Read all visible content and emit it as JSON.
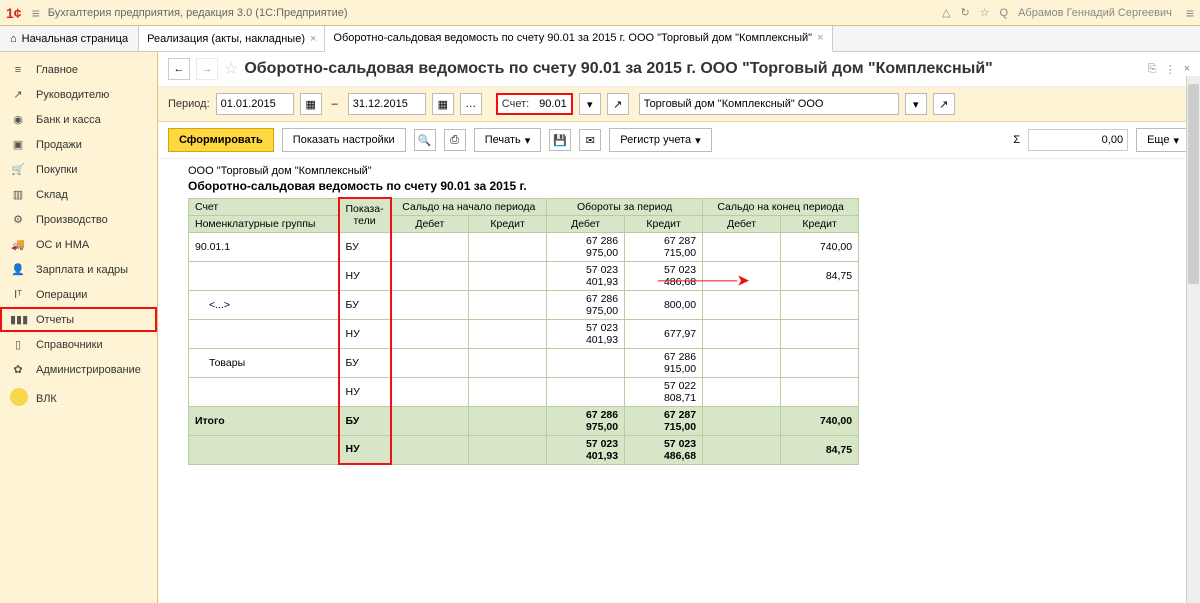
{
  "app": {
    "title": "Бухгалтерия предприятия, редакция 3.0   (1С:Предприятие)",
    "user": "Абрамов Геннадий Сергеевич"
  },
  "tabs": {
    "home": "Начальная страница",
    "t1": "Реализация (акты, накладные)",
    "t2": "Оборотно-сальдовая ведомость по счету 90.01 за 2015 г. ООО \"Торговый дом \"Комплексный\""
  },
  "sidebar": {
    "main": "Главное",
    "mgr": "Руководителю",
    "bank": "Банк и касса",
    "sales": "Продажи",
    "purch": "Покупки",
    "stock": "Склад",
    "prod": "Производство",
    "os": "ОС и НМА",
    "hr": "Зарплата и кадры",
    "ops": "Операции",
    "reports": "Отчеты",
    "refs": "Справочники",
    "admin": "Администрирование",
    "vlk": "ВЛК"
  },
  "header": {
    "title": "Оборотно-сальдовая ведомость по счету 90.01 за 2015 г. ООО \"Торговый дом \"Комплексный\""
  },
  "filter": {
    "period_label": "Период:",
    "from": "01.01.2015",
    "to": "31.12.2015",
    "acct_label": "Счет:",
    "acct": "90.01",
    "org": "Торговый дом \"Комплексный\" ООО"
  },
  "toolbar": {
    "form": "Сформировать",
    "settings": "Показать настройки",
    "print": "Печать",
    "register": "Регистр учета",
    "more": "Еще",
    "sum": "0,00"
  },
  "report": {
    "org": "ООО \"Торговый дом \"Комплексный\"",
    "title": "Оборотно-сальдовая ведомость по счету 90.01 за 2015 г.",
    "cols": {
      "acct": "Счет",
      "nom": "Номенклатурные группы",
      "ind": "Показа-\nтели",
      "sb": "Сальдо на начало периода",
      "to": "Обороты за период",
      "se": "Сальдо на конец периода",
      "d": "Дебет",
      "c": "Кредит"
    },
    "rows": [
      {
        "acct": "90.01.1",
        "ind": "БУ",
        "d": "",
        "c": "",
        "td": "67 286 975,00",
        "tc": "67 287 715,00",
        "ed": "",
        "ec": "740,00"
      },
      {
        "acct": "",
        "ind": "НУ",
        "d": "",
        "c": "",
        "td": "57 023 401,93",
        "tc": "57 023 486,68",
        "ed": "",
        "ec": "84,75"
      },
      {
        "acct": "<...>",
        "ind": "БУ",
        "d": "",
        "c": "",
        "td": "67 286 975,00",
        "tc": "800,00",
        "ed": "",
        "ec": ""
      },
      {
        "acct": "",
        "ind": "НУ",
        "d": "",
        "c": "",
        "td": "57 023 401,93",
        "tc": "677,97",
        "ed": "",
        "ec": ""
      },
      {
        "acct": "Товары",
        "ind": "БУ",
        "d": "",
        "c": "",
        "td": "",
        "tc": "67 286 915,00",
        "ed": "",
        "ec": ""
      },
      {
        "acct": "",
        "ind": "НУ",
        "d": "",
        "c": "",
        "td": "",
        "tc": "57 022 808,71",
        "ed": "",
        "ec": ""
      }
    ],
    "total_label": "Итого",
    "total": [
      {
        "ind": "БУ",
        "d": "",
        "c": "",
        "td": "67 286 975,00",
        "tc": "67 287 715,00",
        "ed": "",
        "ec": "740,00"
      },
      {
        "ind": "НУ",
        "d": "",
        "c": "",
        "td": "57 023 401,93",
        "tc": "57 023 486,68",
        "ed": "",
        "ec": "84,75"
      }
    ]
  }
}
